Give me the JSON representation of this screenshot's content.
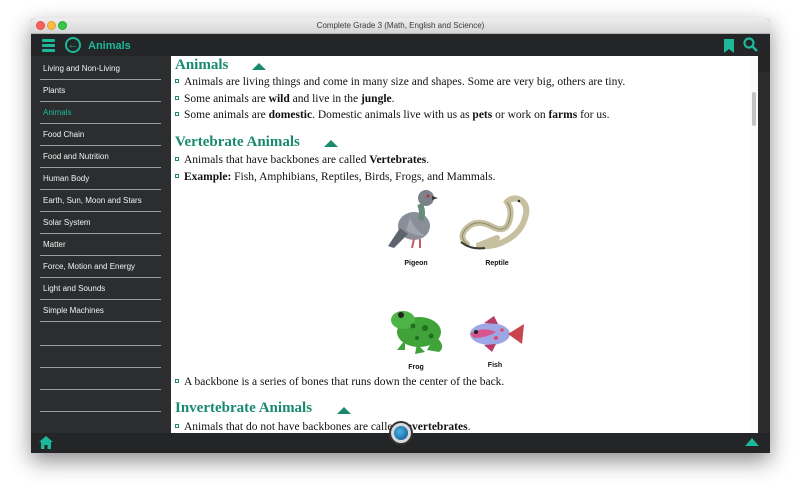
{
  "window": {
    "title": "Complete Grade 3 (Math, English and Science)"
  },
  "appbar": {
    "title": "Animals"
  },
  "sidebar": {
    "items": [
      {
        "label": "Living and Non-Living",
        "active": false
      },
      {
        "label": "Plants",
        "active": false
      },
      {
        "label": "Animals",
        "active": true
      },
      {
        "label": "Food Chain",
        "active": false
      },
      {
        "label": "Food and Nutrition",
        "active": false
      },
      {
        "label": "Human Body",
        "active": false
      },
      {
        "label": "Earth, Sun, Moon and Stars",
        "active": false
      },
      {
        "label": "Solar System",
        "active": false
      },
      {
        "label": "Matter",
        "active": false
      },
      {
        "label": "Force, Motion and Energy",
        "active": false
      },
      {
        "label": "Light and Sounds",
        "active": false
      },
      {
        "label": "Simple Machines",
        "active": false
      }
    ]
  },
  "content": {
    "sections": [
      {
        "heading": "Animals",
        "bullets": [
          {
            "parts": [
              {
                "t": "Animals are living things and come in many size and shapes. Some are very big, others are tiny.",
                "b": false
              }
            ]
          },
          {
            "parts": [
              {
                "t": "Some animals are ",
                "b": false
              },
              {
                "t": "wild",
                "b": true
              },
              {
                "t": " and live in the ",
                "b": false
              },
              {
                "t": "jungle",
                "b": true
              },
              {
                "t": ".",
                "b": false
              }
            ]
          },
          {
            "parts": [
              {
                "t": "Some animals are ",
                "b": false
              },
              {
                "t": "domestic",
                "b": true
              },
              {
                "t": ". Domestic animals live with us as ",
                "b": false
              },
              {
                "t": "pets",
                "b": true
              },
              {
                "t": " or work on ",
                "b": false
              },
              {
                "t": "farms",
                "b": true
              },
              {
                "t": " for us.",
                "b": false
              }
            ]
          }
        ]
      },
      {
        "heading": "Vertebrate Animals",
        "bullets": [
          {
            "parts": [
              {
                "t": "Animals that have backbones are called ",
                "b": false
              },
              {
                "t": "Vertebrates",
                "b": true
              },
              {
                "t": ".",
                "b": false
              }
            ]
          },
          {
            "parts": [
              {
                "t": "Example:",
                "b": true
              },
              {
                "t": " Fish, Amphibians, Reptiles, Birds, Frogs, and Mammals.",
                "b": false
              }
            ]
          }
        ],
        "images": [
          {
            "label": "Pigeon",
            "icon": "pigeon-image"
          },
          {
            "label": "Reptile",
            "icon": "snake-image"
          },
          {
            "label": "Frog",
            "icon": "frog-image"
          },
          {
            "label": "Fish",
            "icon": "fish-image"
          }
        ],
        "after": {
          "parts": [
            {
              "t": "A backbone is a series of bones that runs down the center of the back.",
              "b": false
            }
          ]
        }
      },
      {
        "heading": "Invertebrate Animals",
        "bullets": [
          {
            "parts": [
              {
                "t": "Animals that do not have backbones are called ",
                "b": false
              },
              {
                "t": "Invertebrates",
                "b": true
              },
              {
                "t": ".",
                "b": false
              }
            ]
          }
        ]
      }
    ]
  },
  "colors": {
    "accent": "#1cb89a",
    "heading": "#1a8a6e",
    "sidebar_bg": "#2b2d2f"
  }
}
